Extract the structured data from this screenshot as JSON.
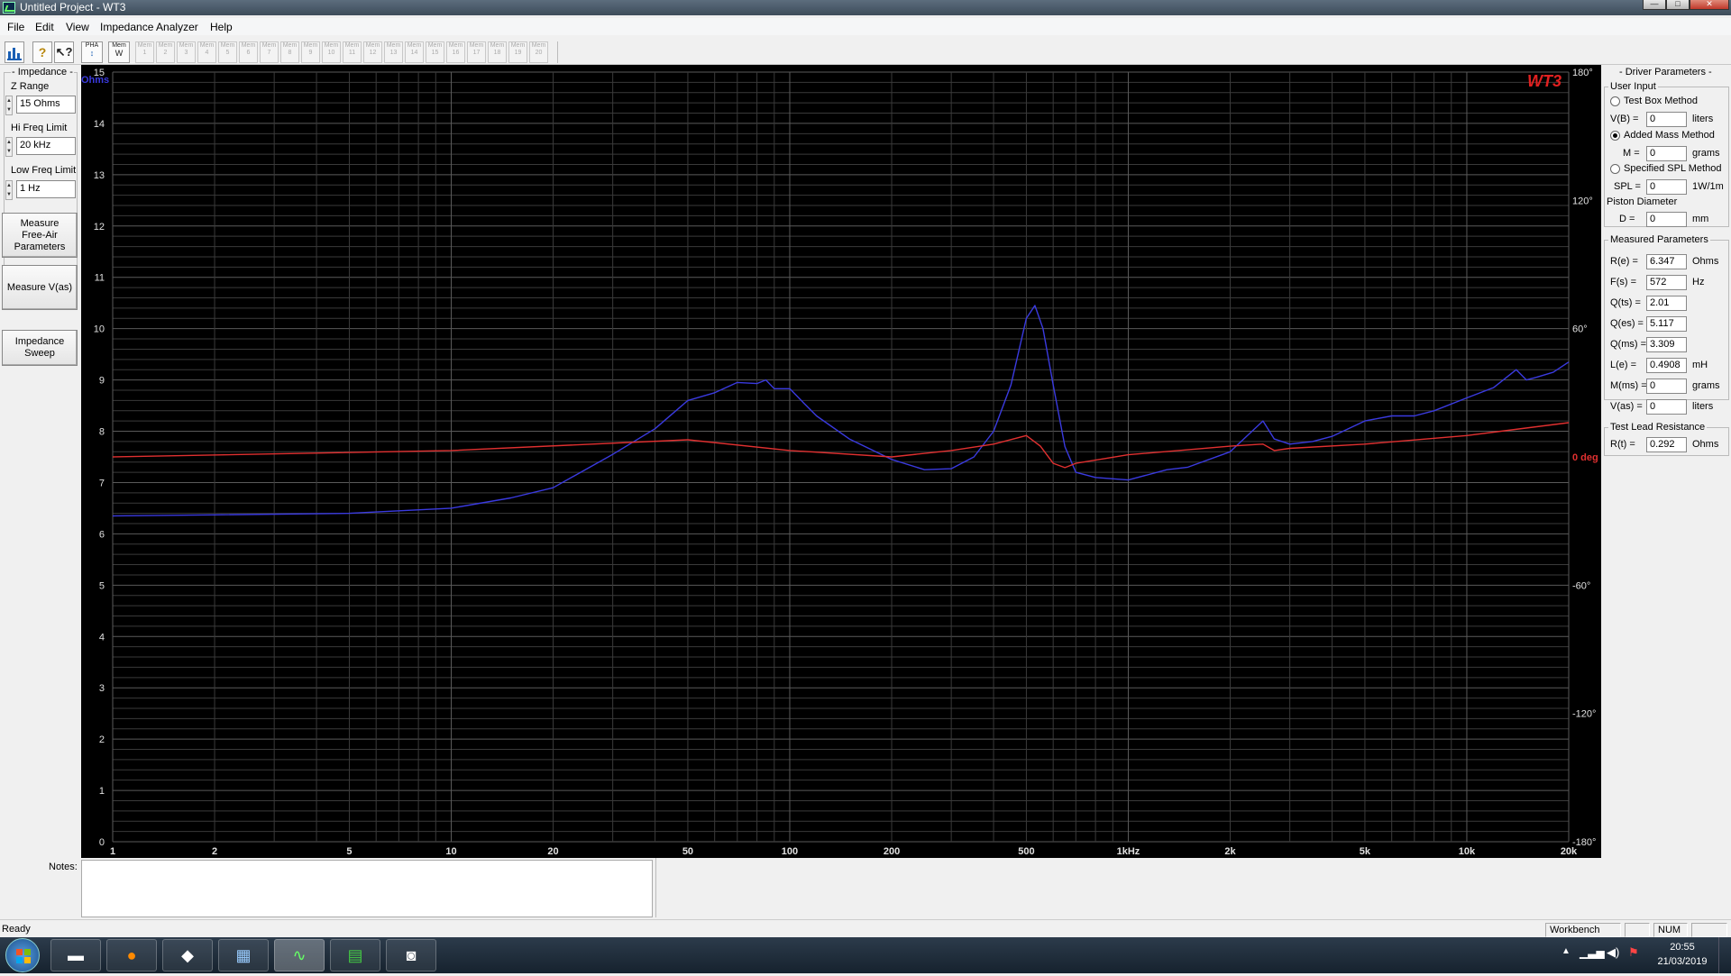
{
  "window": {
    "title": "Untitled Project - WT3"
  },
  "menu": [
    "File",
    "Edit",
    "View",
    "Impedance Analyzer",
    "Help"
  ],
  "toolbar": {
    "pha_label": "PHA",
    "mem_label": "Mem",
    "mem_slots": [
      "1",
      "2",
      "3",
      "4",
      "5",
      "6",
      "7",
      "8",
      "9",
      "10",
      "11",
      "12",
      "13",
      "14",
      "15",
      "16",
      "17",
      "18",
      "19",
      "20"
    ]
  },
  "left": {
    "group_title": "Impedance",
    "z_range": {
      "label": "Z Range",
      "value": "15 Ohms"
    },
    "hi_freq": {
      "label": "Hi Freq Limit",
      "value": "20 kHz"
    },
    "low_freq": {
      "label": "Low Freq Limit",
      "value": "1 Hz"
    },
    "measure_free_air": "Measure Free-Air Parameters",
    "measure_vas": "Measure V(as)",
    "impedance_sweep": "Impedance Sweep"
  },
  "chart_data": {
    "type": "line",
    "brand": "WT3",
    "y_unit": "Ohms",
    "phase_unit": "0 deg",
    "ylim": [
      0,
      15
    ],
    "y_ticks": [
      "0",
      "1",
      "2",
      "3",
      "4",
      "5",
      "6",
      "7",
      "8",
      "9",
      "10",
      "11",
      "12",
      "13",
      "14",
      "15"
    ],
    "phase_lim": [
      -180,
      180
    ],
    "phase_ticks": [
      "180°",
      "120°",
      "60°",
      "0 deg",
      "-60°",
      "-120°",
      "-180°"
    ],
    "x_scale": "log",
    "xlim": [
      1,
      20000
    ],
    "x_ticks": [
      {
        "v": 1,
        "label": "1"
      },
      {
        "v": 2,
        "label": "2"
      },
      {
        "v": 5,
        "label": "5"
      },
      {
        "v": 10,
        "label": "10"
      },
      {
        "v": 20,
        "label": "20"
      },
      {
        "v": 50,
        "label": "50"
      },
      {
        "v": 100,
        "label": "100"
      },
      {
        "v": 200,
        "label": "200"
      },
      {
        "v": 500,
        "label": "500"
      },
      {
        "v": 1000,
        "label": "1kHz"
      },
      {
        "v": 2000,
        "label": "2k"
      },
      {
        "v": 5000,
        "label": "5k"
      },
      {
        "v": 10000,
        "label": "10k"
      },
      {
        "v": 20000,
        "label": "20k"
      }
    ],
    "grid": true,
    "colors": {
      "impedance": "#3a3adf",
      "phase": "#e03030",
      "grid": "#3a3a3a",
      "grid_major": "#5a5a5a",
      "ticks": "#e0e0e0"
    },
    "series": [
      {
        "key": "impedance",
        "x": [
          1,
          2,
          5,
          10,
          15,
          20,
          30,
          40,
          50,
          60,
          70,
          80,
          85,
          90,
          100,
          110,
          120,
          150,
          200,
          250,
          300,
          350,
          400,
          450,
          500,
          530,
          560,
          600,
          650,
          700,
          800,
          1000,
          1300,
          1500,
          2000,
          2500,
          2700,
          3000,
          3500,
          4000,
          5000,
          6000,
          7000,
          8000,
          10000,
          12000,
          14000,
          15000,
          16000,
          18000,
          20000
        ],
        "values": [
          6.35,
          6.37,
          6.4,
          6.5,
          6.7,
          6.9,
          7.55,
          8.05,
          8.6,
          8.75,
          8.95,
          8.93,
          9.0,
          8.83,
          8.83,
          8.55,
          8.3,
          7.85,
          7.45,
          7.25,
          7.27,
          7.5,
          8.0,
          8.9,
          10.2,
          10.45,
          10.0,
          8.9,
          7.7,
          7.2,
          7.1,
          7.05,
          7.25,
          7.3,
          7.6,
          8.2,
          7.85,
          7.75,
          7.8,
          7.9,
          8.2,
          8.3,
          8.3,
          8.4,
          8.65,
          8.85,
          9.2,
          9.0,
          9.05,
          9.15,
          9.35
        ]
      },
      {
        "key": "phase",
        "x": [
          1,
          10,
          50,
          100,
          200,
          300,
          400,
          500,
          550,
          600,
          650,
          700,
          1000,
          2000,
          2500,
          2700,
          3000,
          5000,
          10000,
          20000
        ],
        "values": [
          0,
          3,
          8,
          3,
          0,
          3,
          6,
          10,
          5,
          -3,
          -5,
          -3,
          1,
          5,
          6,
          3,
          4,
          6,
          10,
          16
        ]
      }
    ]
  },
  "right": {
    "title": "Driver Parameters",
    "user_input": "User Input",
    "test_box": "Test Box Method",
    "vb": {
      "label": "V(B) =",
      "value": "0",
      "unit": "liters"
    },
    "added_mass": "Added Mass Method",
    "m": {
      "label": "M =",
      "value": "0",
      "unit": "grams"
    },
    "spl_method": "Specified SPL Method",
    "spl": {
      "label": "SPL =",
      "value": "0",
      "unit": "1W/1m"
    },
    "piston": "Piston Diameter",
    "d": {
      "label": "D =",
      "value": "0",
      "unit": "mm"
    },
    "measured_title": "Measured Parameters",
    "measured": [
      {
        "label": "R(e) =",
        "value": "6.347",
        "unit": "Ohms"
      },
      {
        "label": "F(s) =",
        "value": "572",
        "unit": "Hz"
      },
      {
        "label": "Q(ts) =",
        "value": "2.01",
        "unit": ""
      },
      {
        "label": "Q(es) =",
        "value": "5.117",
        "unit": ""
      },
      {
        "label": "Q(ms) =",
        "value": "3.309",
        "unit": ""
      },
      {
        "label": "L(e) =",
        "value": "0.4908",
        "unit": "mH"
      },
      {
        "label": "M(ms) =",
        "value": "0",
        "unit": "grams"
      },
      {
        "label": "V(as) =",
        "value": "0",
        "unit": "liters"
      }
    ],
    "lead_title": "Test Lead Resistance",
    "rt": {
      "label": "R(t) =",
      "value": "0.292",
      "unit": "Ohms"
    }
  },
  "notes": {
    "label": "Notes:",
    "value": ""
  },
  "status": {
    "text": "Ready",
    "workbench": "Workbench",
    "num": "NUM"
  },
  "taskbar": {
    "time": "20:55",
    "date": "21/03/2019"
  }
}
